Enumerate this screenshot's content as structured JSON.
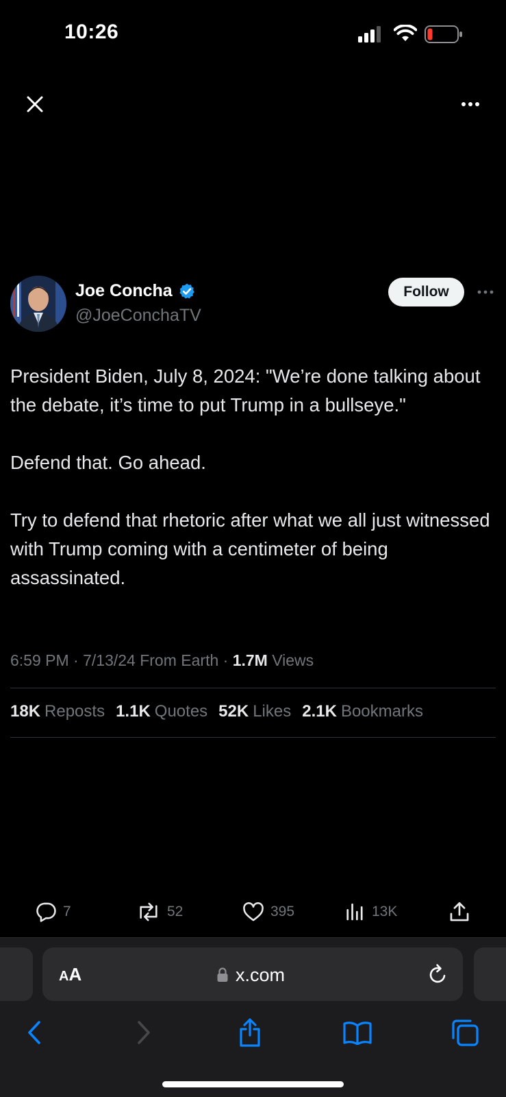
{
  "status_bar": {
    "time": "10:26"
  },
  "tweet": {
    "author_name": "Joe Concha",
    "author_handle": "@JoeConchaTV",
    "follow_label": "Follow",
    "paragraphs": [
      "President Biden, July 8, 2024: \"We’re done talking about the debate, it’s time to put Trump in a bullseye.\"",
      "Defend that. Go ahead.",
      "Try to defend that rhetoric after what we all just witnessed with Trump coming with a centimeter of being assassinated."
    ],
    "meta": {
      "time_date": "6:59 PM · 7/13/24 From Earth · ",
      "views_count": "1.7M",
      "views_label": " Views"
    },
    "stats": {
      "reposts_count": "18K",
      "reposts_label": "Reposts",
      "quotes_count": "1.1K",
      "quotes_label": "Quotes",
      "likes_count": "52K",
      "likes_label": "Likes",
      "bookmarks_count": "2.1K",
      "bookmarks_label": "Bookmarks"
    },
    "actions": {
      "replies": "7",
      "reposts": "52",
      "likes": "395",
      "views": "13K"
    }
  },
  "browser": {
    "aa_small": "A",
    "aa_big": "A",
    "url": "x.com"
  },
  "colors": {
    "verified": "#1d9bf0",
    "safari_accent": "#0a84ff",
    "muted_text": "#71767b",
    "battery_low": "#ff3b30"
  }
}
